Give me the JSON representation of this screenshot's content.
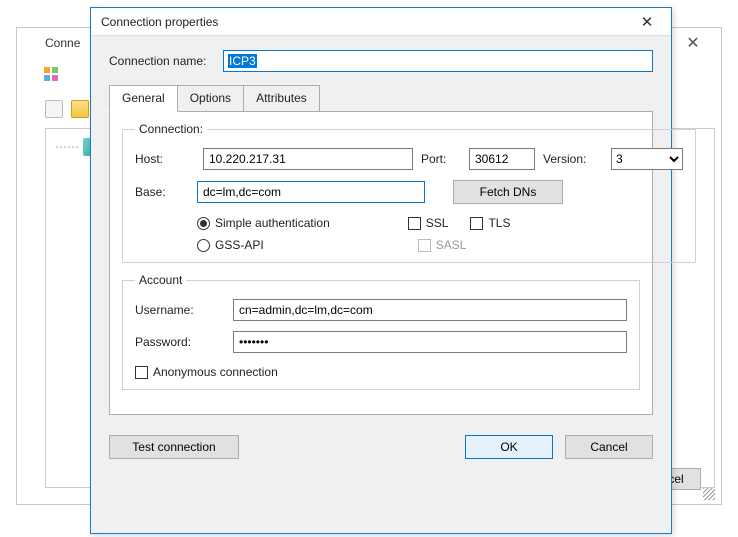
{
  "bg": {
    "title_prefix": "Conne",
    "cancel": "Cancel"
  },
  "modal": {
    "title": "Connection properties",
    "conn_name_label": "Connection name:",
    "conn_name_value": "ICP3",
    "tabs": {
      "general": "General",
      "options": "Options",
      "attributes": "Attributes"
    },
    "connection": {
      "legend": "Connection:",
      "host_label": "Host:",
      "host_value": "10.220.217.31",
      "port_label": "Port:",
      "port_value": "30612",
      "version_label": "Version:",
      "version_value": "3",
      "base_label": "Base:",
      "base_value": "dc=lm,dc=com",
      "fetch": "Fetch DNs",
      "simple_auth": "Simple authentication",
      "gss": "GSS-API",
      "ssl": "SSL",
      "tls": "TLS",
      "sasl": "SASL"
    },
    "account": {
      "legend": "Account",
      "username_label": "Username:",
      "username_value": "cn=admin,dc=lm,dc=com",
      "password_label": "Password:",
      "password_value": "•••••••",
      "anon": "Anonymous connection"
    },
    "footer": {
      "test": "Test connection",
      "ok": "OK",
      "cancel": "Cancel"
    }
  }
}
